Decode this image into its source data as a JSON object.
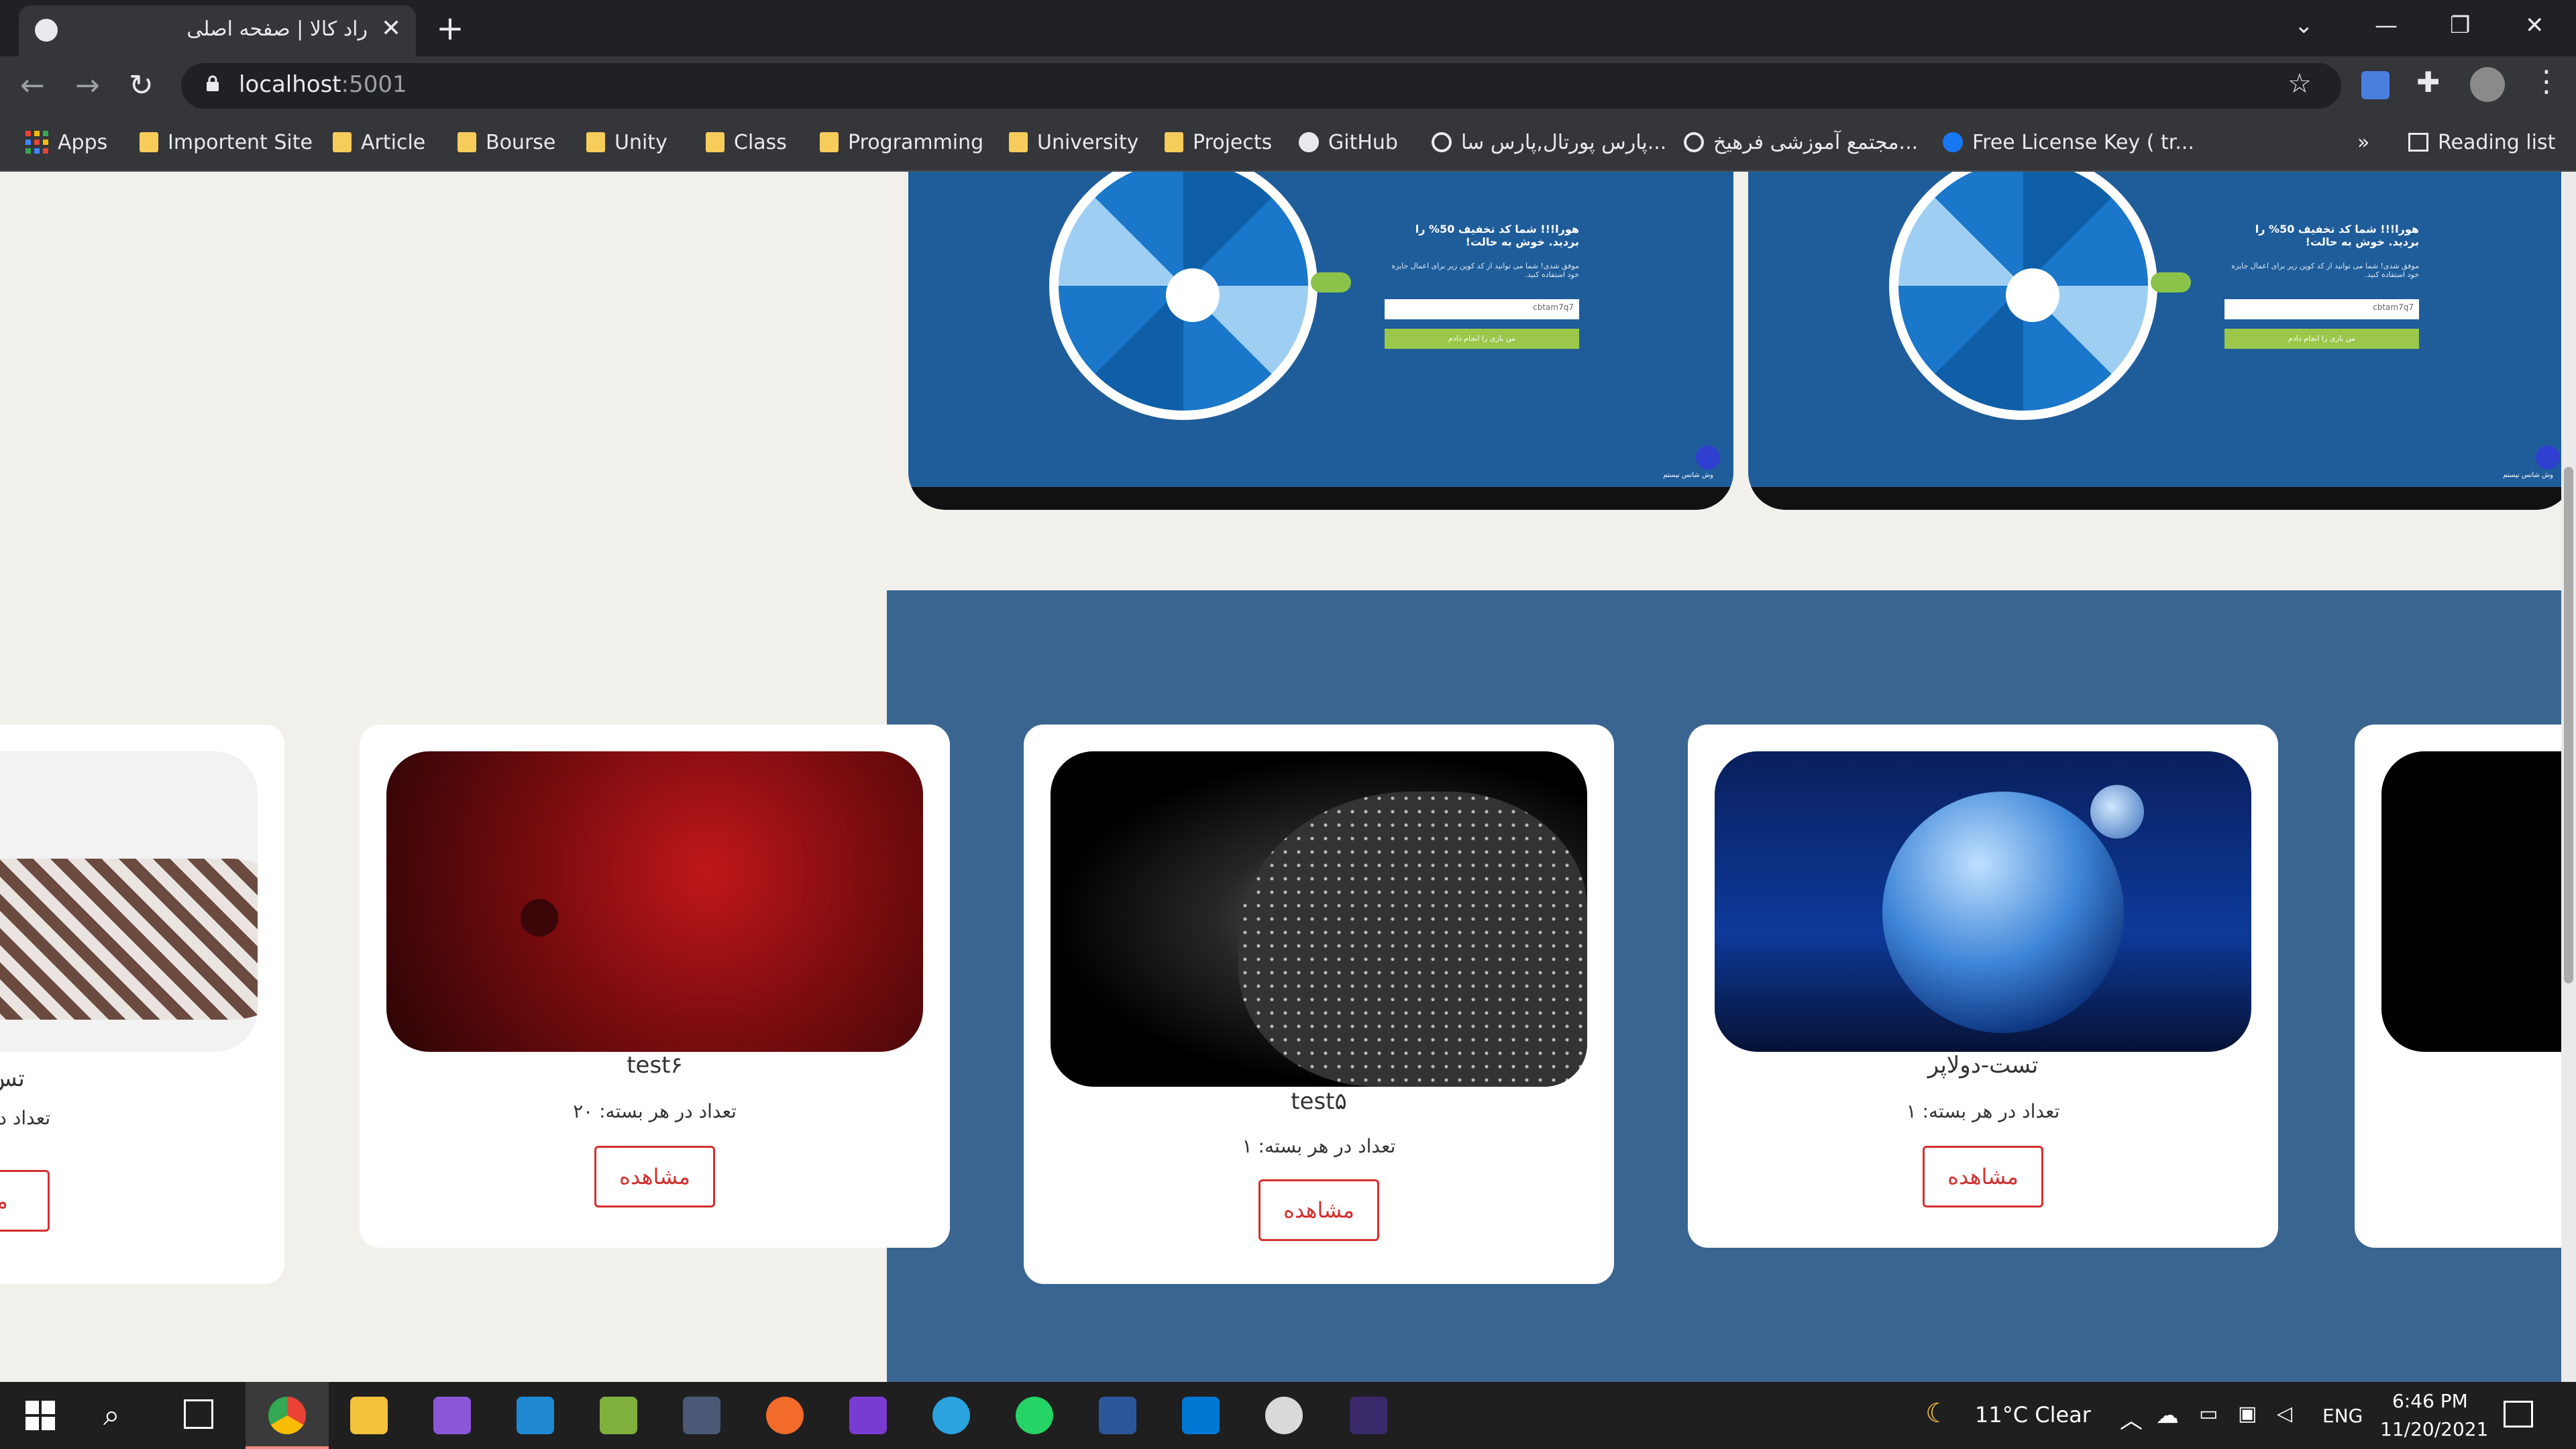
{
  "browser": {
    "tab_title": "راد کالا | صفحه اصلی",
    "tab_close": "✕",
    "new_tab": "+",
    "url_host": "localhost",
    "url_port": ":5001",
    "reading_list": "Reading list",
    "more_bookmarks": "»",
    "bookmarks": [
      {
        "label": "Apps",
        "icon": "apps-grid-icon"
      },
      {
        "label": "Importent Site",
        "icon": "folder-icon"
      },
      {
        "label": "Article",
        "icon": "folder-icon"
      },
      {
        "label": "Bourse",
        "icon": "folder-icon"
      },
      {
        "label": "Unity",
        "icon": "folder-icon"
      },
      {
        "label": "Class",
        "icon": "folder-icon"
      },
      {
        "label": "Programming",
        "icon": "folder-icon"
      },
      {
        "label": "University",
        "icon": "folder-icon"
      },
      {
        "label": "Projects",
        "icon": "folder-icon"
      },
      {
        "label": "GitHub",
        "icon": "github-icon"
      },
      {
        "label": "پارس پورتال,پارس سا...",
        "icon": "globe-icon"
      },
      {
        "label": "مجتمع آموزشی فرهیخ...",
        "icon": "globe-icon"
      },
      {
        "label": "Free License Key ( tr...",
        "icon": "facebook-icon"
      }
    ]
  },
  "promo": {
    "headline": "هورا!!! شما کد تخفیف 50% را بردید. خوش به حالت!",
    "subtext": "موفق شدی! شما می توانید از کد کوپن زیر برای اعمال جایزه خود استفاده کنید.",
    "coupon": "cbtam7q7",
    "button": "من بازی را انجام دادم",
    "footer": "وش شانس نیستم"
  },
  "products": [
    {
      "title": "تس",
      "count_label": "تعداد در",
      "button": "مشا"
    },
    {
      "title": "test۶",
      "count_label": "تعداد در هر بسته: ۲۰",
      "button": "مشاهده"
    },
    {
      "title": "test۵",
      "count_label": "تعداد در هر بسته: ۱",
      "button": "مشاهده"
    },
    {
      "title": "تست-دولاپر",
      "count_label": "تعداد در هر بسته: ۱",
      "button": "مشاهده"
    }
  ],
  "taskbar": {
    "weather": "11°C  Clear",
    "language": "ENG",
    "time": "6:46 PM",
    "date": "11/20/2021"
  },
  "colors": {
    "page_bg": "#f1f0eb",
    "band_blue": "#3a6591",
    "accent_red": "#d32f2f",
    "chrome_dark": "#202124",
    "chrome_mid": "#35363a"
  }
}
